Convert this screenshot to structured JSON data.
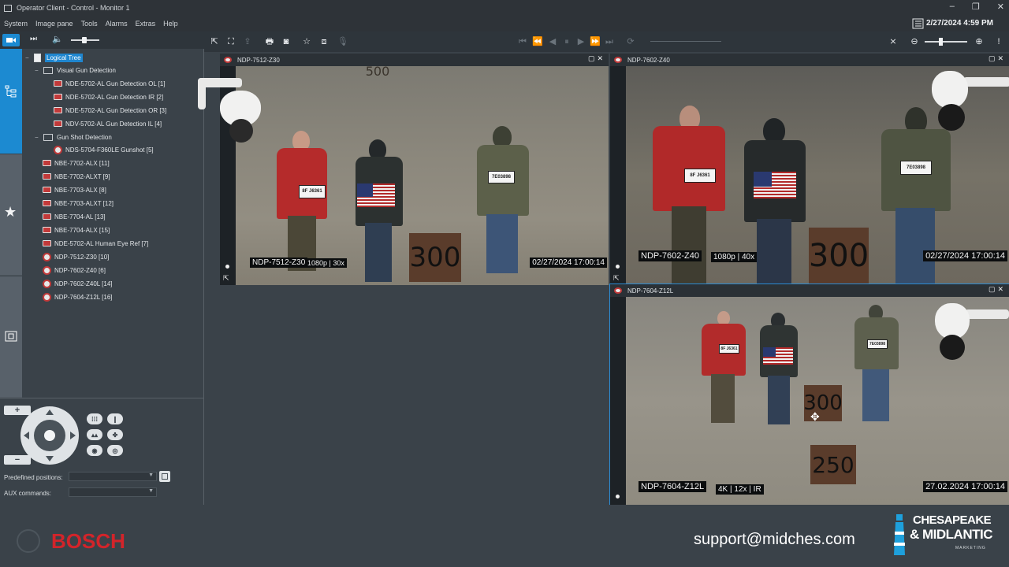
{
  "window": {
    "title": "Operator Client - Control - Monitor 1",
    "controls": [
      "–",
      "❐",
      "✕"
    ]
  },
  "menu": {
    "items": [
      "System",
      "Image pane",
      "Tools",
      "Alarms",
      "Extras",
      "Help"
    ],
    "datetime": "2/27/2024 4:59 PM"
  },
  "tree": {
    "root": "Logical Tree",
    "groups": [
      {
        "label": "Visual Gun Detection",
        "children": [
          "NDE-5702-AL  Gun Detection OL [1]",
          "NDE-5702-AL Gun Detection IR [2]",
          "NDE-5702-AL Gun Detection OR [3]",
          "NDV-5702-AL Gun Detection IL [4]"
        ]
      },
      {
        "label": "Gun Shot Detection",
        "children": [
          "NDS-5704-F360LE Gunshot [5]"
        ]
      }
    ],
    "cameras": [
      "NBE-7702-ALX [11]",
      "NBE-7702-ALXT [9]",
      "NBE-7703-ALX [8]",
      "NBE-7703-ALXT [12]",
      "NBE-7704-AL [13]",
      "NBE-7704-ALX [15]",
      "NDE-5702-AL Human Eye Ref [7]",
      "NDP-7512-Z30 [10]",
      "NDP-7602-Z40 [6]",
      "NDP-7602-Z40L [14]",
      "NDP-7604-Z12L [16]"
    ]
  },
  "ptz": {
    "zoom_in": "+",
    "zoom_out": "−",
    "predefined_label": "Predefined positions:",
    "aux_label": "AUX commands:"
  },
  "panes": [
    {
      "title": "NDP-7512-Z30",
      "osd_name": "NDP-7512-Z30",
      "osd_res": "1080p | 30x",
      "osd_time": "02/27/2024  17:00:14",
      "plate_left": "8F J6361",
      "plate_right": "7E03898",
      "board_near": "300",
      "board_far": "500"
    },
    {
      "title": "NDP-7602-Z40",
      "osd_name": "NDP-7602-Z40",
      "osd_res": "1080p | 40x",
      "osd_time": "02/27/2024 17:00:14",
      "plate_left": "8F J6361",
      "plate_right": "7E03898",
      "board_near": "300"
    },
    {
      "title": "NDP-7604-Z12L",
      "osd_name": "NDP-7604-Z12L",
      "osd_res": "4K | 12x | IR",
      "osd_time": "27.02.2024 17:00:14",
      "plate_left": "8F J6361",
      "plate_right": "7E03898",
      "board_near": "300",
      "board_far": "250"
    }
  ],
  "footer": {
    "bosch": "BOSCH",
    "support_email": "support@midches.com",
    "brand_line1": "CHESAPEAKE",
    "brand_line2": "& MIDLANTIC",
    "brand_line3": "MARKETING"
  },
  "colors": {
    "accent": "#1c8ad1",
    "bosch_red": "#d3242a",
    "background": "#3a4249"
  }
}
